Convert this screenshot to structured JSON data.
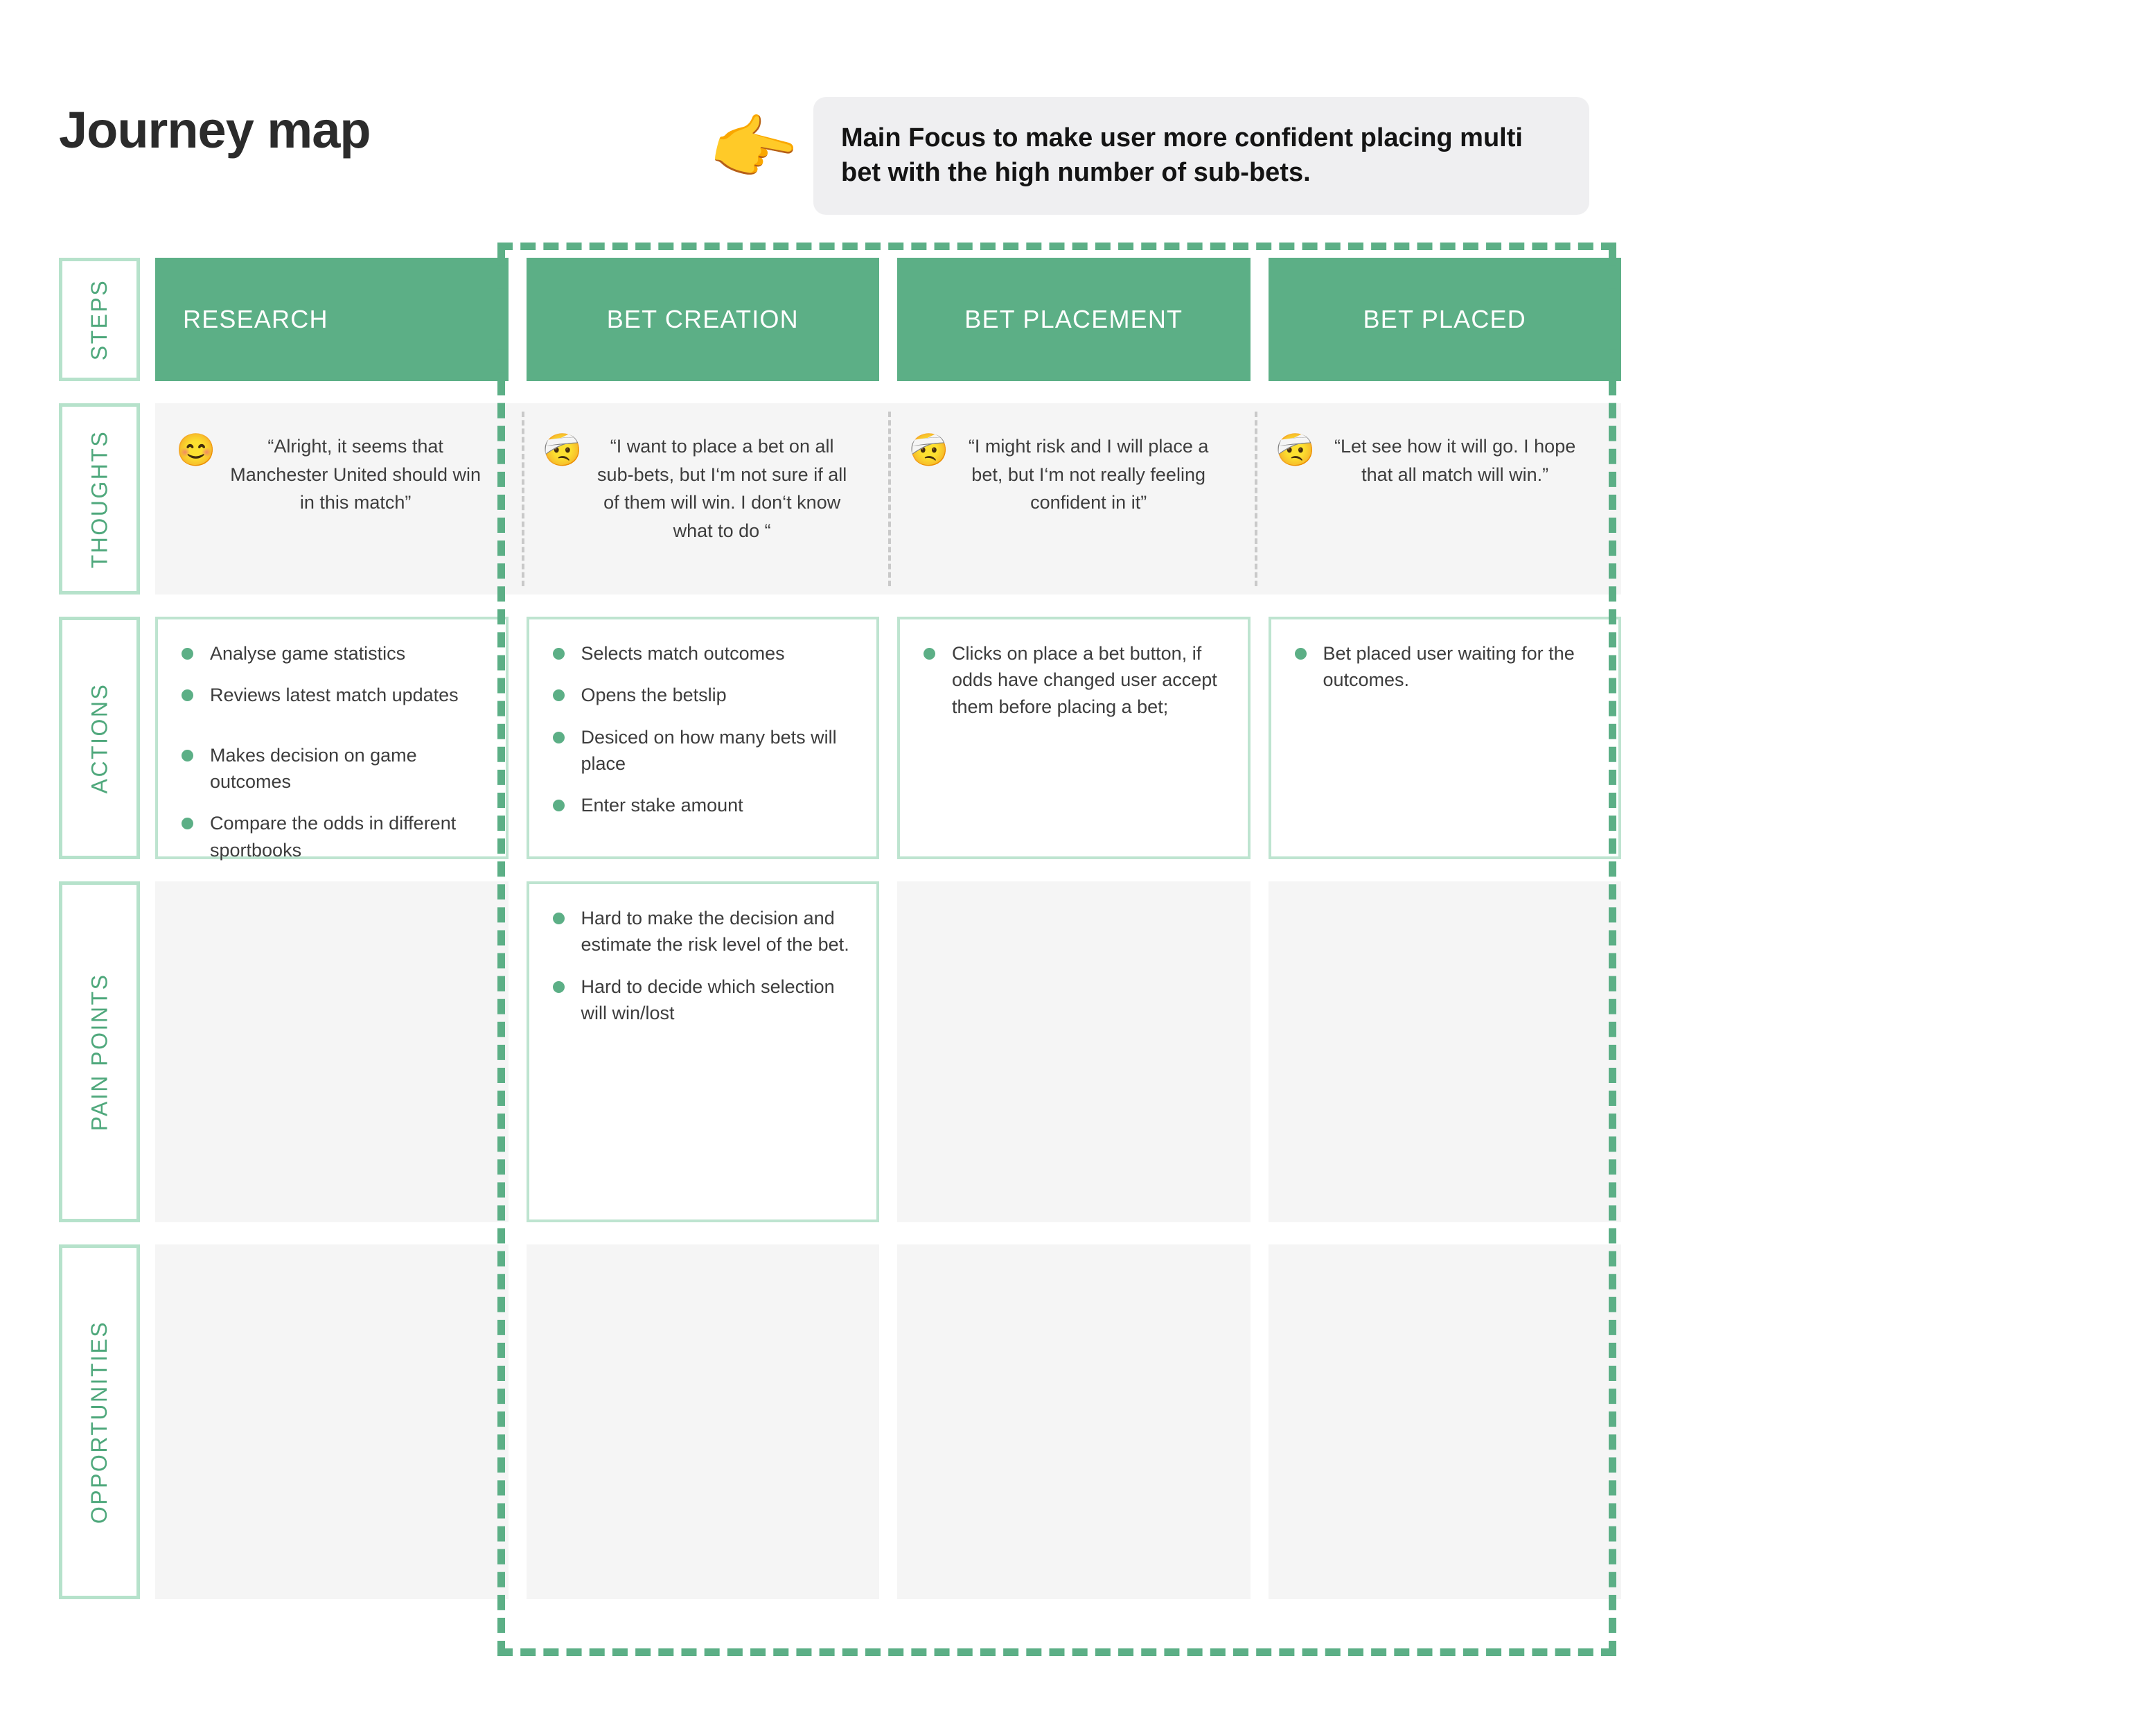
{
  "header": {
    "title": "Journey map",
    "callout": {
      "icon": "pointing-hand-emoji",
      "text": "Main Focus to make user more confident placing multi bet with the high number of sub-bets."
    }
  },
  "colors": {
    "accent_green": "#5CAF86",
    "light_green_border": "#BEE4D0",
    "label_green": "#4FA87C",
    "cell_gray": "#F5F5F5",
    "callout_gray": "#EFEFF1"
  },
  "rows": {
    "steps": {
      "label": "STEPS"
    },
    "thoughts": {
      "label": "THOUGHTS"
    },
    "actions": {
      "label": "ACTIONS"
    },
    "pain_points": {
      "label": "PAIN POINTS"
    },
    "opportunities": {
      "label": "OPPORTUNITIES"
    }
  },
  "steps": [
    {
      "label": "RESEARCH"
    },
    {
      "label": "BET CREATION"
    },
    {
      "label": "BET PLACEMENT"
    },
    {
      "label": "BET PLACED"
    }
  ],
  "thoughts": [
    {
      "emoji": "relieved-smiling-face-green",
      "glyph": "😊",
      "text": "“Alright, it seems that Manchester United should win in this match”"
    },
    {
      "emoji": "head-bandage-worried-face",
      "glyph": "🤕",
      "text": "“I want to place a bet on all sub-bets, but I‘m not sure if all of them will win. I don‘t know what to do “"
    },
    {
      "emoji": "head-bandage-worried-face",
      "glyph": "🤕",
      "text": "“I might risk and I will place a bet, but I‘m not really feeling confident in it”"
    },
    {
      "emoji": "head-bandage-worried-face",
      "glyph": "🤕",
      "text": "“Let see how it will go. I hope that all match will win.”"
    }
  ],
  "actions": [
    {
      "items": [
        "Analyse  game statistics",
        "Reviews latest match updates",
        "Makes decision on game outcomes",
        "Compare the odds in different sportbooks"
      ]
    },
    {
      "items": [
        "Selects match outcomes",
        "Opens the betslip",
        "Desiced on how many bets will place",
        "Enter stake amount"
      ]
    },
    {
      "items": [
        "Clicks on place a bet button, if odds have changed user accept them before placing a bet;"
      ]
    },
    {
      "items": [
        "Bet placed user waiting for the outcomes."
      ]
    }
  ],
  "pain_points": [
    {
      "items": []
    },
    {
      "items": [
        "Hard to make the decision and estimate the risk level of the bet.",
        "Hard to decide which selection will win/lost"
      ]
    },
    {
      "items": []
    },
    {
      "items": []
    }
  ],
  "opportunities": [
    {
      "items": []
    },
    {
      "items": []
    },
    {
      "items": []
    },
    {
      "items": []
    }
  ]
}
